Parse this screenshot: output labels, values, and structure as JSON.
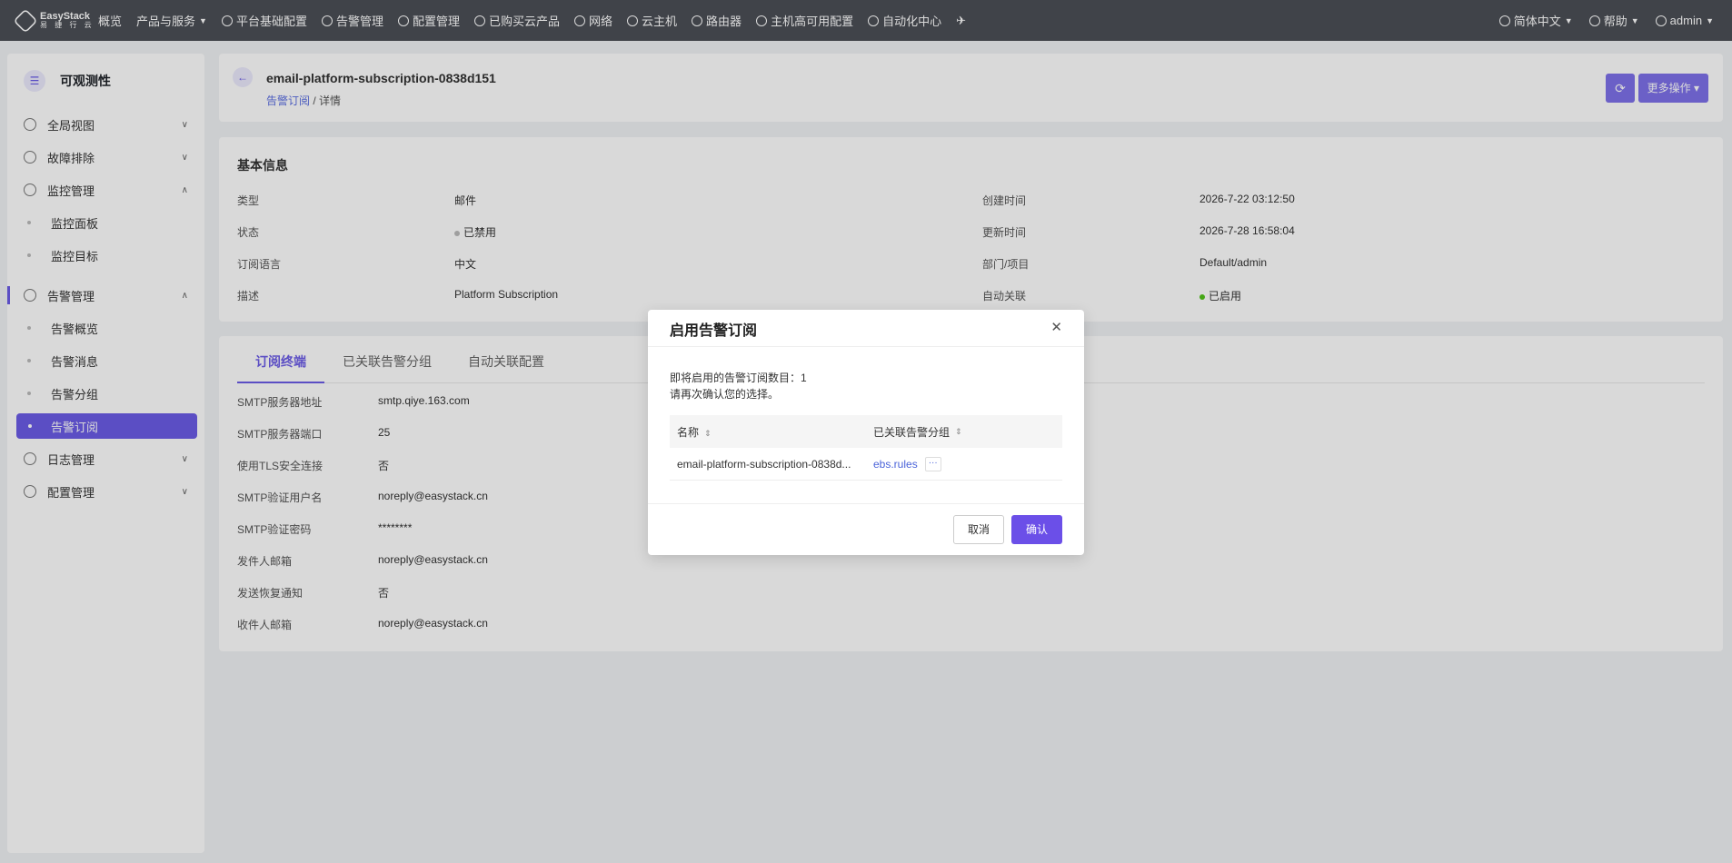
{
  "topnav": {
    "logo_line1": "EasyStack",
    "logo_line2": "易 捷 行 云",
    "items": [
      "概览",
      "产品与服务",
      "平台基础配置",
      "告警管理",
      "配置管理",
      "已购买云产品",
      "网络",
      "云主机",
      "路由器",
      "主机高可用配置",
      "自动化中心"
    ],
    "language": "简体中文",
    "help": "帮助",
    "user": "admin"
  },
  "sidebar": {
    "title": "可观测性",
    "items": [
      {
        "label": "全局视图"
      },
      {
        "label": "故障排除"
      },
      {
        "label": "监控管理"
      },
      {
        "label": "监控面板"
      },
      {
        "label": "监控目标"
      },
      {
        "label": "告警管理"
      },
      {
        "label": "告警概览"
      },
      {
        "label": "告警消息"
      },
      {
        "label": "告警分组"
      },
      {
        "label": "告警订阅"
      },
      {
        "label": "日志管理"
      },
      {
        "label": "配置管理"
      }
    ]
  },
  "header": {
    "title": "email-platform-subscription-0838d151",
    "breadcrumb_link": "告警订阅",
    "breadcrumb_sep": " / ",
    "breadcrumb_current": "详情",
    "more_label": "更多操作"
  },
  "basic": {
    "title": "基本信息",
    "left": [
      {
        "k": "类型",
        "v": "邮件"
      },
      {
        "k": "状态",
        "v": "已禁用"
      },
      {
        "k": "订阅语言",
        "v": "中文"
      },
      {
        "k": "描述",
        "v": "Platform Subscription"
      }
    ],
    "right": [
      {
        "k": "创建时间",
        "v": "2026-7-22 03:12:50"
      },
      {
        "k": "更新时间",
        "v": "2026-7-28 16:58:04"
      },
      {
        "k": "部门/项目",
        "v": "Default/admin"
      },
      {
        "k": "自动关联",
        "v": "已启用"
      }
    ]
  },
  "tabs": [
    "订阅终端",
    "已关联告警分组",
    "自动关联配置"
  ],
  "smtp": [
    {
      "k": "SMTP服务器地址",
      "v": "smtp.qiye.163.com"
    },
    {
      "k": "SMTP服务器端口",
      "v": "25"
    },
    {
      "k": "使用TLS安全连接",
      "v": "否"
    },
    {
      "k": "SMTP验证用户名",
      "v": "noreply@easystack.cn"
    },
    {
      "k": "SMTP验证密码",
      "v": "********"
    },
    {
      "k": "发件人邮箱",
      "v": "noreply@easystack.cn"
    },
    {
      "k": "发送恢复通知",
      "v": "否"
    },
    {
      "k": "收件人邮箱",
      "v": "noreply@easystack.cn"
    }
  ],
  "modal": {
    "title": "启用告警订阅",
    "line1": "即将启用的告警订阅数目：1",
    "line2": "请再次确认您的选择。",
    "col_name": "名称",
    "col_group": "已关联告警分组",
    "row_name": "email-platform-subscription-0838d...",
    "row_group": "ebs.rules",
    "row_more": "···",
    "cancel": "取消",
    "confirm": "确认"
  }
}
